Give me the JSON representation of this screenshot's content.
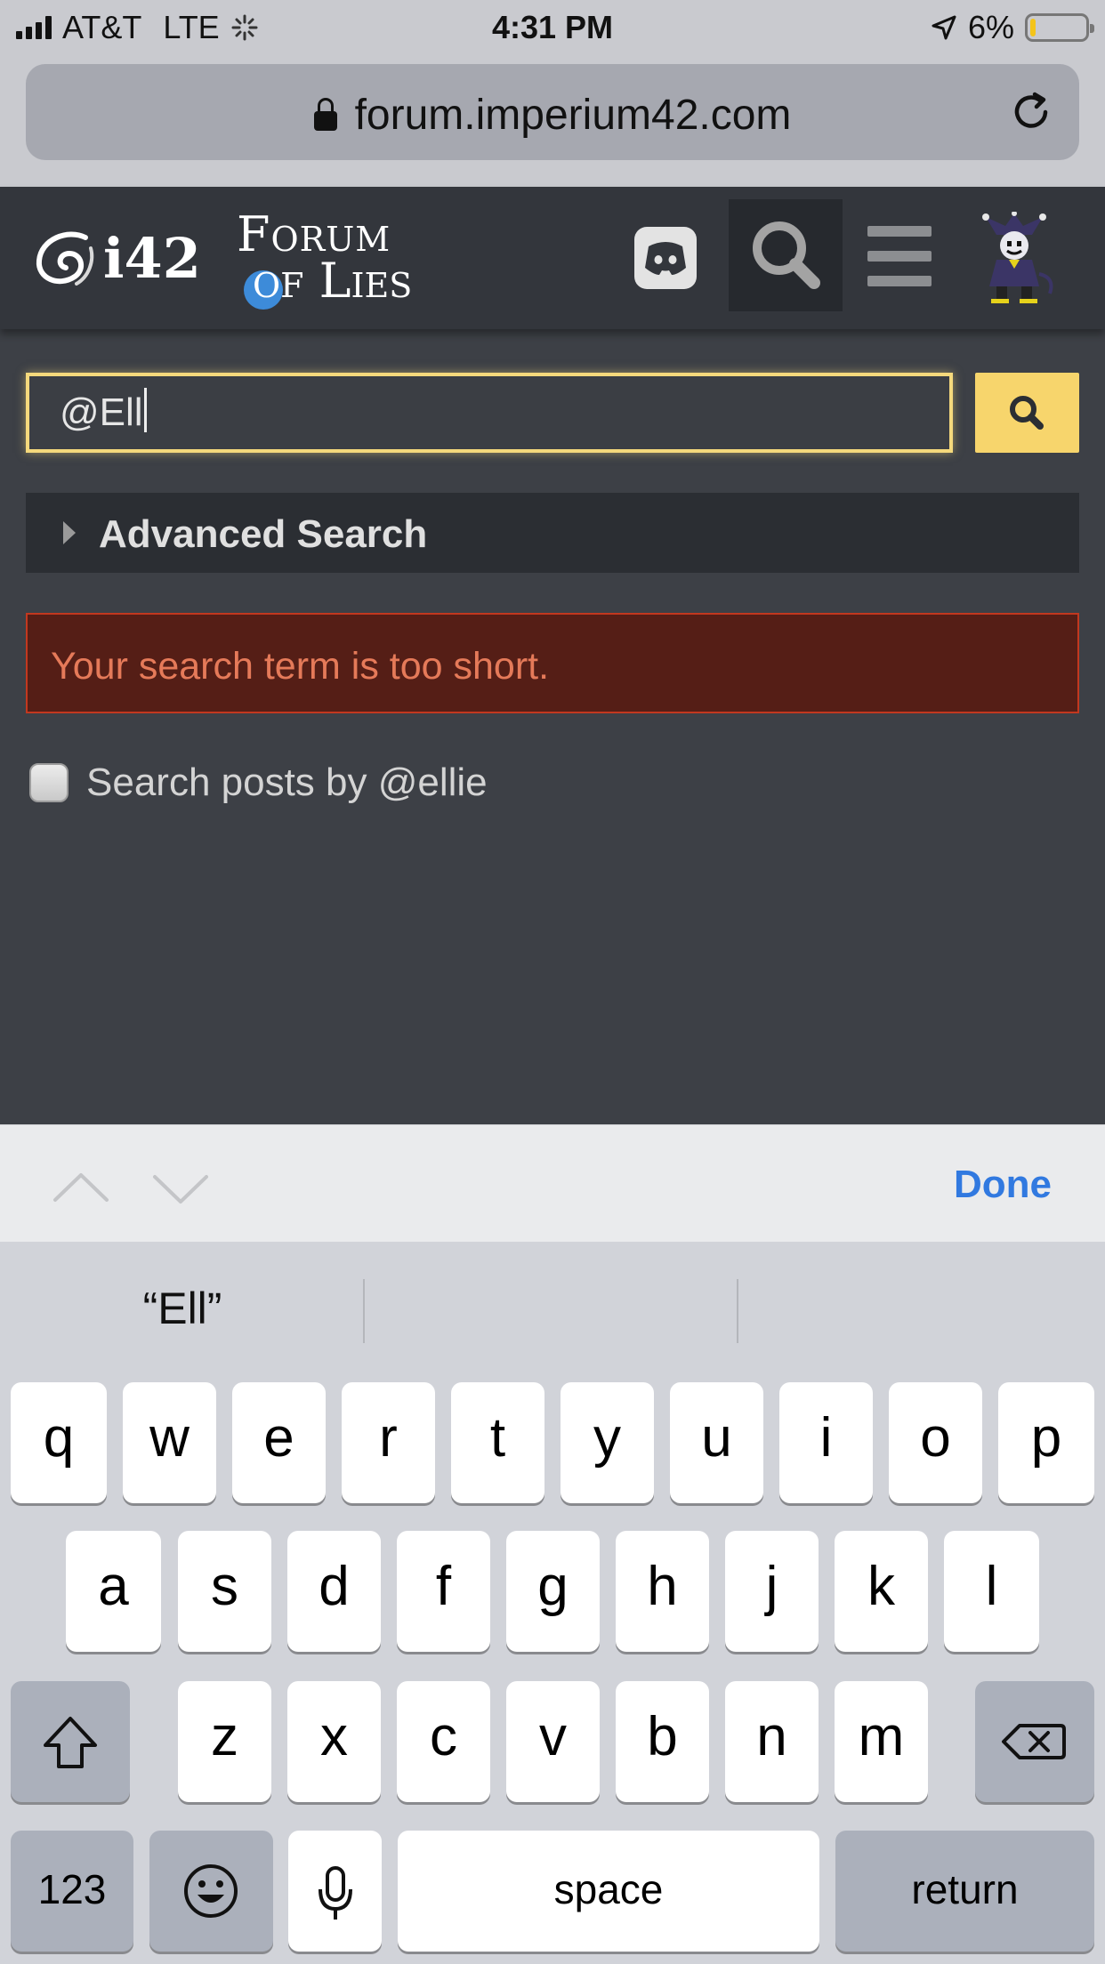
{
  "status_bar": {
    "carrier": "AT&T",
    "network": "LTE",
    "time": "4:31 PM",
    "battery": "6%"
  },
  "browser": {
    "url": "forum.imperium42.com"
  },
  "header": {
    "logo_text": "i42",
    "forum_logo_line1": "Forum",
    "forum_logo_line2": "of Lies"
  },
  "search": {
    "query": "@Ell",
    "advanced_label": "Advanced Search",
    "error_message": "Your search term is too short.",
    "checkbox_label": "Search posts by @ellie",
    "checkbox_checked": false
  },
  "accessory_bar": {
    "done_label": "Done"
  },
  "keyboard": {
    "suggestions": [
      "“Ell”",
      "",
      ""
    ],
    "row1": [
      "q",
      "w",
      "e",
      "r",
      "t",
      "y",
      "u",
      "i",
      "o",
      "p"
    ],
    "row2": [
      "a",
      "s",
      "d",
      "f",
      "g",
      "h",
      "j",
      "k",
      "l"
    ],
    "row3": [
      "z",
      "x",
      "c",
      "v",
      "b",
      "n",
      "m"
    ],
    "numbers_label": "123",
    "space_label": "space",
    "return_label": "return"
  }
}
